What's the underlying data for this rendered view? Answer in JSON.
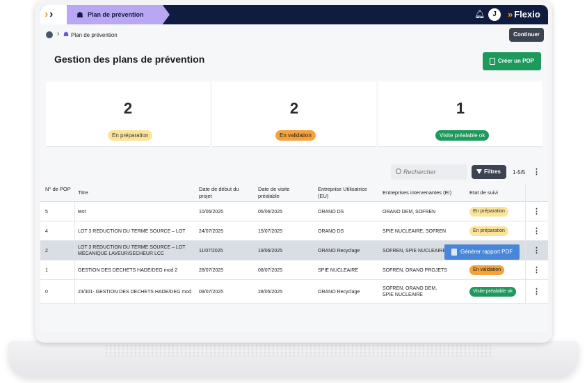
{
  "app": {
    "breadcrumb_tab": "Plan de prévention",
    "brand": "Flexio",
    "user_initial": "J"
  },
  "breadcrumb": {
    "current": "Plan de prévention",
    "continue_label": "Continuer"
  },
  "header": {
    "title": "Gestion des plans de prévention",
    "create_label": "Créer un POP"
  },
  "stats": [
    {
      "count": "2",
      "label": "En préparation",
      "color": "#fbe49a"
    },
    {
      "count": "2",
      "label": "En validation",
      "color": "#f4a23b"
    },
    {
      "count": "1",
      "label": "Visite préalable ok",
      "color": "#1d9a5b"
    }
  ],
  "toolbar": {
    "search_placeholder": "Rechercher",
    "filters_label": "Filtres",
    "pagination": "1-5/5"
  },
  "table": {
    "headers": [
      "N° de POP",
      "Titre",
      "Date de début du projet",
      "Date de visite préalable",
      "Entreprise Utilisatrice (EU)",
      "Entreprises intervenantes (EI)",
      "Etat de suivi"
    ],
    "rows": [
      {
        "num": "5",
        "title": "test",
        "start": "10/06/2025",
        "visit": "05/06/2025",
        "eu": "ORANO DS",
        "ei": "ORANO DEM, SOFREN",
        "status": "En préparation"
      },
      {
        "num": "4",
        "title": "LOT 3 REDUCTION DU TERME SOURCE – LOT",
        "start": "24/07/2025",
        "visit": "15/07/2025",
        "eu": "ORANO DS",
        "ei": "SPIE NUCLEAIRE, SOFREN",
        "status": "En préparation"
      },
      {
        "num": "2",
        "title": "LOT 3 REDUCTION DU TERME SOURCE – LOT MECANIQUE LAVEUR/SECHEUR LCC",
        "start": "11/07/2025",
        "visit": "19/06/2025",
        "eu": "ORANO Recyclage",
        "ei": "SOFREN, SPIE NUCLEAIRE",
        "status": ""
      },
      {
        "num": "1",
        "title": "GESTION DES DECHETS HADE/DEG mod 2",
        "start": "28/07/2025",
        "visit": "08/07/2025",
        "eu": "SPIE NUCLEAIRE",
        "ei": "SOFREN, ORANO PROJETS",
        "status": "En validation"
      },
      {
        "num": "0",
        "title": "23/301- GESTION DES DECHETS HADE/DEG mod",
        "start": "09/07/2025",
        "visit": "28/05/2025",
        "eu": "ORANO Recyclage",
        "ei": "SOFREN, ORANO DEM, SPIE NUCLEAIRE",
        "status": "Visite préalable ok"
      }
    ],
    "context_action": "Générer rapport PDF"
  }
}
